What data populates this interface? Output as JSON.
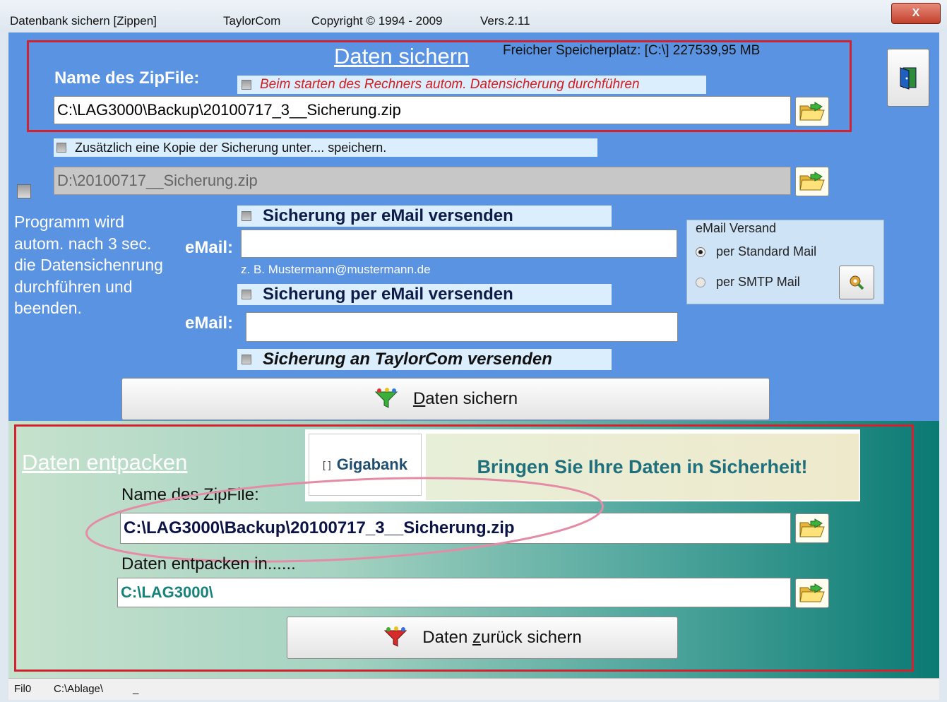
{
  "window": {
    "title": "Datenbank sichern [Zippen]",
    "company": "TaylorCom",
    "copyright": "Copyright © 1994 - 2009",
    "version": "Vers.2.11",
    "close_label": "X"
  },
  "backup": {
    "heading": "Daten sichern",
    "free_space": "Freicher Speicherplatz: [C:\\] 227539,95 MB",
    "zip_label": "Name des ZipFile:",
    "autostart_label": "Beim starten des Rechners autom. Datensicherung durchführen",
    "zip_path": "C:\\LAG3000\\Backup\\20100717_3__Sicherung.zip",
    "copy_label": "Zusätzlich eine Kopie der Sicherung unter.... speichern.",
    "copy_path": "D:\\20100717__Sicherung.zip",
    "auto_program_text": [
      "Programm wird",
      "autom. nach 3 sec.",
      "die Datensichenrung",
      "durchführen und",
      "beenden."
    ],
    "email1_label": "Sicherung per eMail versenden",
    "email_field_label": "eMail:",
    "email1_value": "",
    "email_example": "z. B. Mustermann@mustermann.de",
    "email2_label": "Sicherung per eMail versenden",
    "email2_value": "",
    "taylorcom_label": "Sicherung an TaylorCom versenden",
    "save_button": "Daten sichern",
    "save_button_accesskey": "D",
    "save_button_rest": "aten sichern"
  },
  "email_versand": {
    "title": "eMail Versand",
    "option_standard": "per Standard Mail",
    "option_smtp": "per SMTP Mail",
    "selected": "per Standard Mail"
  },
  "restore": {
    "heading": "Daten entpacken",
    "zip_label": "Name des ZipFile:",
    "zip_path": "C:\\LAG3000\\Backup\\20100717_3__Sicherung.zip",
    "target_label": "Daten entpacken in......",
    "target_path": "C:\\LAG3000\\",
    "restore_button_pre": "Daten ",
    "restore_button_accesskey": "z",
    "restore_button_post": "urück sichern"
  },
  "banner": {
    "brand": "Gigabank",
    "slogan": "Bringen Sie Ihre Daten in Sicherheit!"
  },
  "status": {
    "field1": "Fil0",
    "field2": "C:\\Ablage\\",
    "field3": "_"
  },
  "colors": {
    "upper_bg": "#5a93e1",
    "highlight_red": "#d3222f",
    "slogan": "#1f6f7d"
  }
}
